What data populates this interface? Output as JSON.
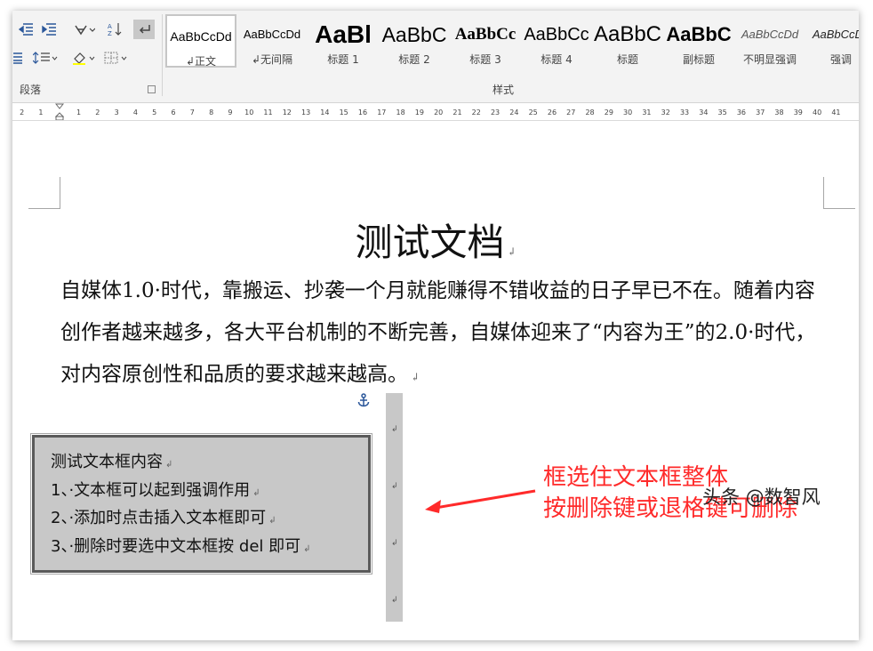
{
  "ribbon": {
    "paragraph_group_label": "段落",
    "styles_group_label": "样式",
    "styles": [
      {
        "preview": "AaBbCcDd",
        "name": "↲正文",
        "selected": true
      },
      {
        "preview": "AaBbCcDd",
        "name": "↲无间隔"
      },
      {
        "preview": "AaBl",
        "name": "标题 1"
      },
      {
        "preview": "AaBbC",
        "name": "标题 2"
      },
      {
        "preview": "AaBbCc",
        "name": "标题 3"
      },
      {
        "preview": "AaBbCc",
        "name": "标题 4"
      },
      {
        "preview": "AaBbC",
        "name": "标题"
      },
      {
        "preview": "AaBbC",
        "name": "副标题"
      },
      {
        "preview": "AaBbCcDd",
        "name": "不明显强调"
      },
      {
        "preview": "AaBbCcDd",
        "name": "强调"
      }
    ]
  },
  "ruler": {
    "ticks": [
      "2",
      "1",
      "",
      "1",
      "2",
      "3",
      "4",
      "5",
      "6",
      "7",
      "8",
      "9",
      "10",
      "11",
      "12",
      "13",
      "14",
      "15",
      "16",
      "17",
      "18",
      "19",
      "20",
      "21",
      "22",
      "23",
      "24",
      "25",
      "26",
      "27",
      "28",
      "29",
      "30",
      "31",
      "32",
      "33",
      "34",
      "35",
      "36",
      "37",
      "38",
      "39",
      "40",
      "41"
    ]
  },
  "document": {
    "title": "测试文档",
    "paragraph": "自媒体1.0·时代，靠搬运、抄袭一个月就能赚得不错收益的日子早已不在。随着内容创作者越来越多，各大平台机制的不断完善，自媒体迎来了“内容为王”的2.0·时代，对内容原创性和品质的要求越来越高。",
    "paragraph_mark": "↲",
    "textbox": {
      "lines": [
        "测试文本框内容",
        "1、·文本框可以起到强调作用",
        "2、·添加时点击插入文本框即可",
        "3、·删除时要选中文本框按 del 即可"
      ]
    }
  },
  "annotation": {
    "lines": [
      "框选住文本框整体",
      "按删除键或退格键可删除"
    ],
    "color": "#ff2a2a"
  },
  "watermark": "头条 @数智风"
}
